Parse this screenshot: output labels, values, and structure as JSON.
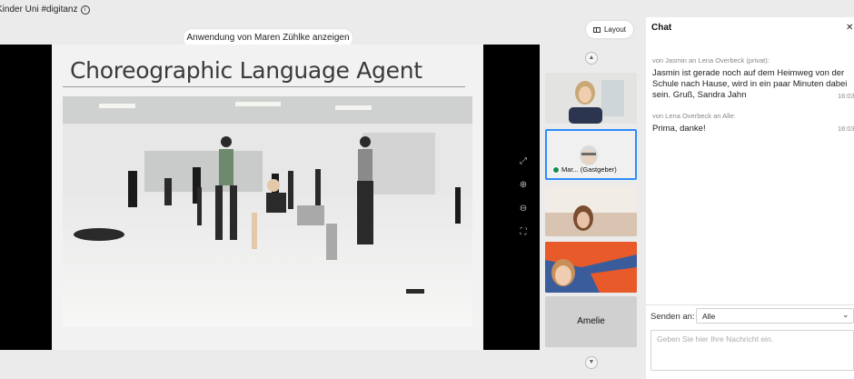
{
  "meeting": {
    "title": "Kinder Uni #digitanz",
    "info_icon": "info-icon"
  },
  "share_banner": {
    "prefix": "Anwendung von",
    "presenter": "Maren Zühlke",
    "suffix": "anzeigen"
  },
  "slide": {
    "title": "Choreographic Language Agent"
  },
  "stage_controls": [
    "expand-icon",
    "zoom-in-icon",
    "zoom-out-icon",
    "fit-screen-icon"
  ],
  "layout_button": {
    "label": "Layout"
  },
  "participants": [
    {
      "name": "",
      "host": ""
    },
    {
      "name": "Mar...",
      "host": "(Gastgeber)"
    },
    {
      "name": "",
      "host": ""
    },
    {
      "name": "",
      "host": ""
    },
    {
      "name": "Amelie",
      "host": ""
    }
  ],
  "chat": {
    "title": "Chat",
    "close_icon": "close-icon",
    "messages": [
      {
        "meta": "von Jasmin an Lena Overbeck (privat):",
        "text": "Jasmin ist gerade noch auf dem Heimweg von der Schule nach Hause, wird in ein paar Minuten dabei sein. Gruß, Sandra Jahn",
        "time": "16:03"
      },
      {
        "meta": "von Lena Overbeck an Alle:",
        "text": "Prima, danke!",
        "time": "16:03"
      }
    ],
    "send_to_label": "Senden an:",
    "send_to_value": "Alle",
    "input_placeholder": "Geben Sie hier Ihre Nachricht ein."
  },
  "colors": {
    "accent": "#2d8cff",
    "host_status": "#1a8a4a"
  }
}
